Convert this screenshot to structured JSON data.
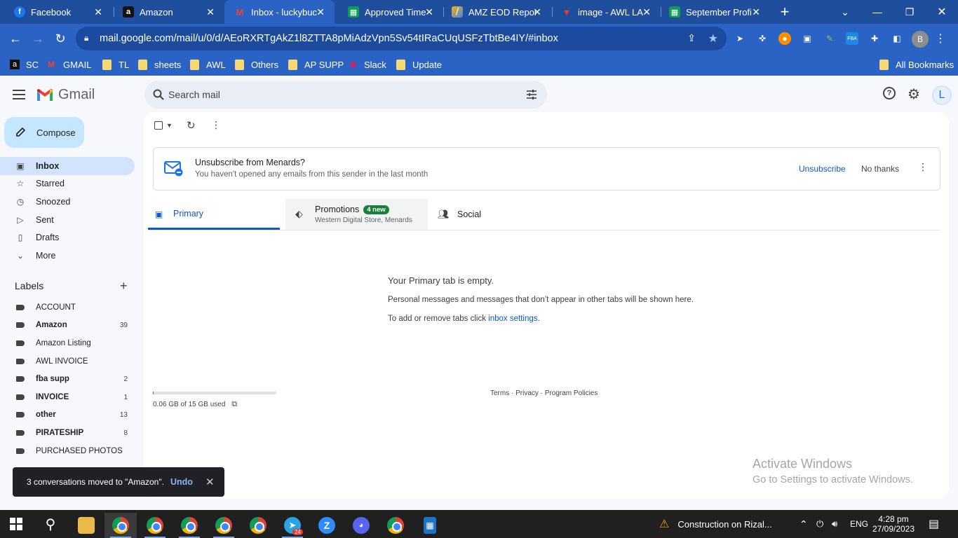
{
  "browser": {
    "tabs": [
      {
        "title": "Facebook",
        "favicon": "facebook-icon"
      },
      {
        "title": "Amazon",
        "favicon": "amazon-icon"
      },
      {
        "title": "Inbox - luckybuc",
        "favicon": "gmail-icon"
      },
      {
        "title": "Approved Time",
        "favicon": "sheets-icon"
      },
      {
        "title": "AMZ EOD Repor",
        "favicon": "report-icon"
      },
      {
        "title": "image - AWL LA",
        "favicon": "image-icon"
      },
      {
        "title": "September Profi",
        "favicon": "sheets-icon"
      }
    ],
    "new_tab_label": "+",
    "url": "mail.google.com/mail/u/0/d/AEoRXRTgAkZ1l8ZTTA8pMiAdzVpn5Sv54tIRaCUqUSFzTbtBe4IY/#inbox",
    "profile_initial": "B",
    "bookmarks": [
      "SC",
      "GMAIL",
      "TL",
      "sheets",
      "AWL",
      "Others",
      "AP SUPP",
      "Slack",
      "Update"
    ],
    "all_bookmarks_label": "All Bookmarks"
  },
  "gmail": {
    "logo_text": "Gmail",
    "search_placeholder": "Search mail",
    "account_initial": "L",
    "compose_label": "Compose",
    "nav": [
      {
        "label": "Inbox",
        "icon": "inbox-icon"
      },
      {
        "label": "Starred",
        "icon": "star-icon"
      },
      {
        "label": "Snoozed",
        "icon": "clock-icon"
      },
      {
        "label": "Sent",
        "icon": "send-icon"
      },
      {
        "label": "Drafts",
        "icon": "draft-icon"
      },
      {
        "label": "More",
        "icon": "chevron-down-icon"
      }
    ],
    "labels_heading": "Labels",
    "labels": [
      {
        "name": "ACCOUNT",
        "count": "",
        "bold": false
      },
      {
        "name": "Amazon",
        "count": "39",
        "bold": true
      },
      {
        "name": "Amazon Listing",
        "count": "",
        "bold": false
      },
      {
        "name": "AWL INVOICE",
        "count": "",
        "bold": false
      },
      {
        "name": "fba supp",
        "count": "2",
        "bold": true
      },
      {
        "name": "INVOICE",
        "count": "1",
        "bold": true
      },
      {
        "name": "other",
        "count": "13",
        "bold": true
      },
      {
        "name": "PIRATESHIP",
        "count": "8",
        "bold": true
      },
      {
        "name": "PURCHASED PHOTOS",
        "count": "",
        "bold": false
      }
    ],
    "banner": {
      "title": "Unsubscribe from Menards?",
      "subtitle": "You haven't opened any emails from this sender in the last month",
      "unsubscribe": "Unsubscribe",
      "no_thanks": "No thanks"
    },
    "tabs": {
      "primary": "Primary",
      "promotions": "Promotions",
      "promotions_badge": "4 new",
      "promotions_sub": "Western Digital Store, Menards",
      "social": "Social"
    },
    "empty": {
      "title": "Your Primary tab is empty.",
      "line1": "Personal messages and messages that don’t appear in other tabs will be shown here.",
      "line2_prefix": "To add or remove tabs click ",
      "line2_link": "inbox settings",
      "line2_suffix": "."
    },
    "storage": {
      "text": "0.06 GB of 15 GB used",
      "fraction": 0.004
    },
    "footer": "Terms · Privacy · Program Policies",
    "toast": {
      "message": "3 conversations moved to \"Amazon\".",
      "undo": "Undo"
    }
  },
  "watermark": {
    "line1": "Activate Windows",
    "line2": "Go to Settings to activate Windows."
  },
  "taskbar": {
    "telegram_badge": "24",
    "weather": "Construction on Rizal...",
    "lang": "ENG",
    "time": "4:28 pm",
    "date": "27/09/2023"
  }
}
